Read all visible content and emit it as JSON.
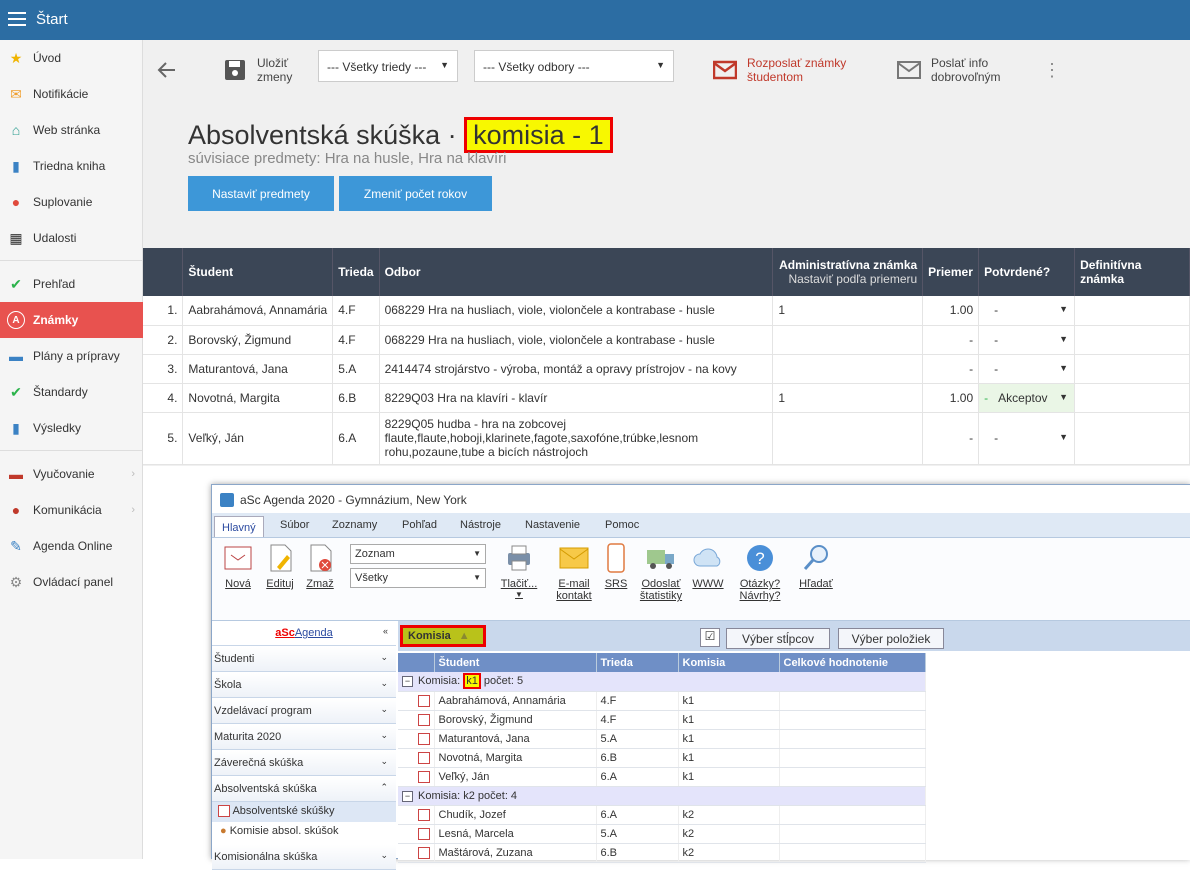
{
  "topbar": {
    "title": "Štart"
  },
  "sidebar": {
    "items": [
      {
        "label": "Úvod",
        "icon": "star-icon",
        "glyph": "★",
        "color": "#f0b400"
      },
      {
        "label": "Notifikácie",
        "icon": "envelope-icon",
        "glyph": "✉",
        "color": "#f0a030"
      },
      {
        "label": "Web stránka",
        "icon": "home-icon",
        "glyph": "⌂",
        "color": "#2a9d8f"
      },
      {
        "label": "Triedna kniha",
        "icon": "book-icon",
        "glyph": "▮",
        "color": "#3b82c4"
      },
      {
        "label": "Suplovanie",
        "icon": "person-icon",
        "glyph": "●",
        "color": "#e04a3c"
      },
      {
        "label": "Udalosti",
        "icon": "calendar-icon",
        "glyph": "▦",
        "color": "#333"
      },
      {
        "label": "Prehľad",
        "icon": "check-circle-icon",
        "glyph": "✔",
        "color": "#2bb34b"
      },
      {
        "label": "Známky",
        "icon": "grade-icon",
        "glyph": "A",
        "color": "#fff"
      },
      {
        "label": "Plány a prípravy",
        "icon": "briefcase-icon",
        "glyph": "▬",
        "color": "#3b82c4"
      },
      {
        "label": "Štandardy",
        "icon": "shield-icon",
        "glyph": "✔",
        "color": "#2bb34b"
      },
      {
        "label": "Výsledky",
        "icon": "bar-chart-icon",
        "glyph": "▮",
        "color": "#3b82c4"
      },
      {
        "label": "Vyučovanie",
        "icon": "briefcase-red-icon",
        "glyph": "▬",
        "color": "#c0392b"
      },
      {
        "label": "Komunikácia",
        "icon": "chat-icon",
        "glyph": "●",
        "color": "#c0392b"
      },
      {
        "label": "Agenda Online",
        "icon": "pen-icon",
        "glyph": "✎",
        "color": "#3b82c4"
      },
      {
        "label": "Ovládací panel",
        "icon": "gear-icon",
        "glyph": "⚙",
        "color": "#888"
      }
    ]
  },
  "toolbar": {
    "save_l1": "Uložiť",
    "save_l2": "zmeny",
    "class_filter": "--- Všetky triedy ---",
    "field_filter": "--- Všetky odbory ---",
    "send_l1": "Rozposlať známky",
    "send_l2": "študentom",
    "info_l1": "Poslať info",
    "info_l2": "dobrovoľným"
  },
  "page": {
    "title_a": "Absolventská skúška · ",
    "title_b": "komisia - 1",
    "subtitle": "súvisiace predmety: Hra na husle, Hra na klavíri",
    "btn_subjects": "Nastaviť predmety",
    "btn_years": "Zmeniť počet rokov"
  },
  "table": {
    "headers": {
      "student": "Študent",
      "class": "Trieda",
      "field": "Odbor",
      "admin": "Administratívna známka",
      "admin_sub": "Nastaviť podľa priemeru",
      "avg": "Priemer",
      "confirmed": "Potvrdené?",
      "final": "Definitívna známka"
    },
    "rows": [
      {
        "n": "1.",
        "student": "Aabrahámová, Annamária",
        "class": "4.F",
        "field": "068229 Hra na husliach, viole, violončele a kontrabase - husle",
        "admin": "1",
        "avg": "1.00",
        "conf_pre": "",
        "conf": "-"
      },
      {
        "n": "2.",
        "student": "Borovský, Žigmund",
        "class": "4.F",
        "field": "068229 Hra na husliach, viole, violončele a kontrabase - husle",
        "admin": "",
        "avg": "-",
        "conf_pre": "",
        "conf": "-"
      },
      {
        "n": "3.",
        "student": "Maturantová, Jana",
        "class": "5.A",
        "field": "2414474 strojárstvo - výroba, montáž a opravy prístrojov - na kovy",
        "admin": "",
        "avg": "-",
        "conf_pre": "",
        "conf": "-"
      },
      {
        "n": "4.",
        "student": "Novotná, Margita",
        "class": "6.B",
        "field": "8229Q03 Hra na klavíri - klavír",
        "admin": "1",
        "avg": "1.00",
        "conf_pre": "-",
        "conf": "Akceptov"
      },
      {
        "n": "5.",
        "student": "Veľký, Ján",
        "class": "6.A",
        "field": "8229Q05 hudba - hra na zobcovej flaute,flaute,hoboji,klarinete,fagote,saxofóne,trúbke,lesnom rohu,pozaune,tube a bicích nástrojoch",
        "admin": "",
        "avg": "-",
        "conf_pre": "",
        "conf": "-"
      }
    ]
  },
  "window": {
    "title": "aSc Agenda 2020 - Gymnázium, New York",
    "menu": [
      "Hlavný",
      "Súbor",
      "Zoznamy",
      "Pohľad",
      "Nástroje",
      "Nastavenie",
      "Pomoc"
    ],
    "ribbon": {
      "new": "Nová",
      "edit": "Edituj",
      "delete": "Zmaž",
      "list_combo": "Zoznam",
      "all_combo": "Všetky",
      "print": "Tlačiť...",
      "email_l1": "E-mail",
      "email_l2": "kontakt",
      "srs": "SRS",
      "stats_l1": "Odoslať",
      "stats_l2": "štatistiky",
      "www": "WWW",
      "q_l1": "Otázky?",
      "q_l2": "Návrhy?",
      "search": "Hľadať"
    },
    "left": {
      "brand_a": "aSc",
      "brand_b": "Agenda",
      "rows": [
        "Študenti",
        "Škola",
        "Vzdelávací program",
        "Maturita 2020",
        "Záverečná skúška",
        "Absolventská skúška"
      ],
      "sub1": "Absolventské skúšky",
      "sub2": "Komisie absol. skúšok",
      "last": "Komisionálna skúška"
    },
    "grid": {
      "group_tag": "Komisia",
      "checkbox": "☑",
      "btn_cols": "Výber stĺpcov",
      "btn_items": "Výber položiek",
      "headers": [
        "Študent",
        "Trieda",
        "Komisia",
        "Celkové hodnotenie"
      ],
      "group1_a": "Komisia: ",
      "group1_k": "k1",
      "group1_b": " počet: 5",
      "group2": "Komisia: k2 počet: 4",
      "rows1": [
        [
          "Aabrahámová, Annamária",
          "4.F",
          "k1"
        ],
        [
          "Borovský, Žigmund",
          "4.F",
          "k1"
        ],
        [
          "Maturantová, Jana",
          "5.A",
          "k1"
        ],
        [
          "Novotná, Margita",
          "6.B",
          "k1"
        ],
        [
          "Veľký, Ján",
          "6.A",
          "k1"
        ]
      ],
      "rows2": [
        [
          "Chudík, Jozef",
          "6.A",
          "k2"
        ],
        [
          "Lesná, Marcela",
          "5.A",
          "k2"
        ],
        [
          "Maštárová, Zuzana",
          "6.B",
          "k2"
        ]
      ]
    }
  }
}
